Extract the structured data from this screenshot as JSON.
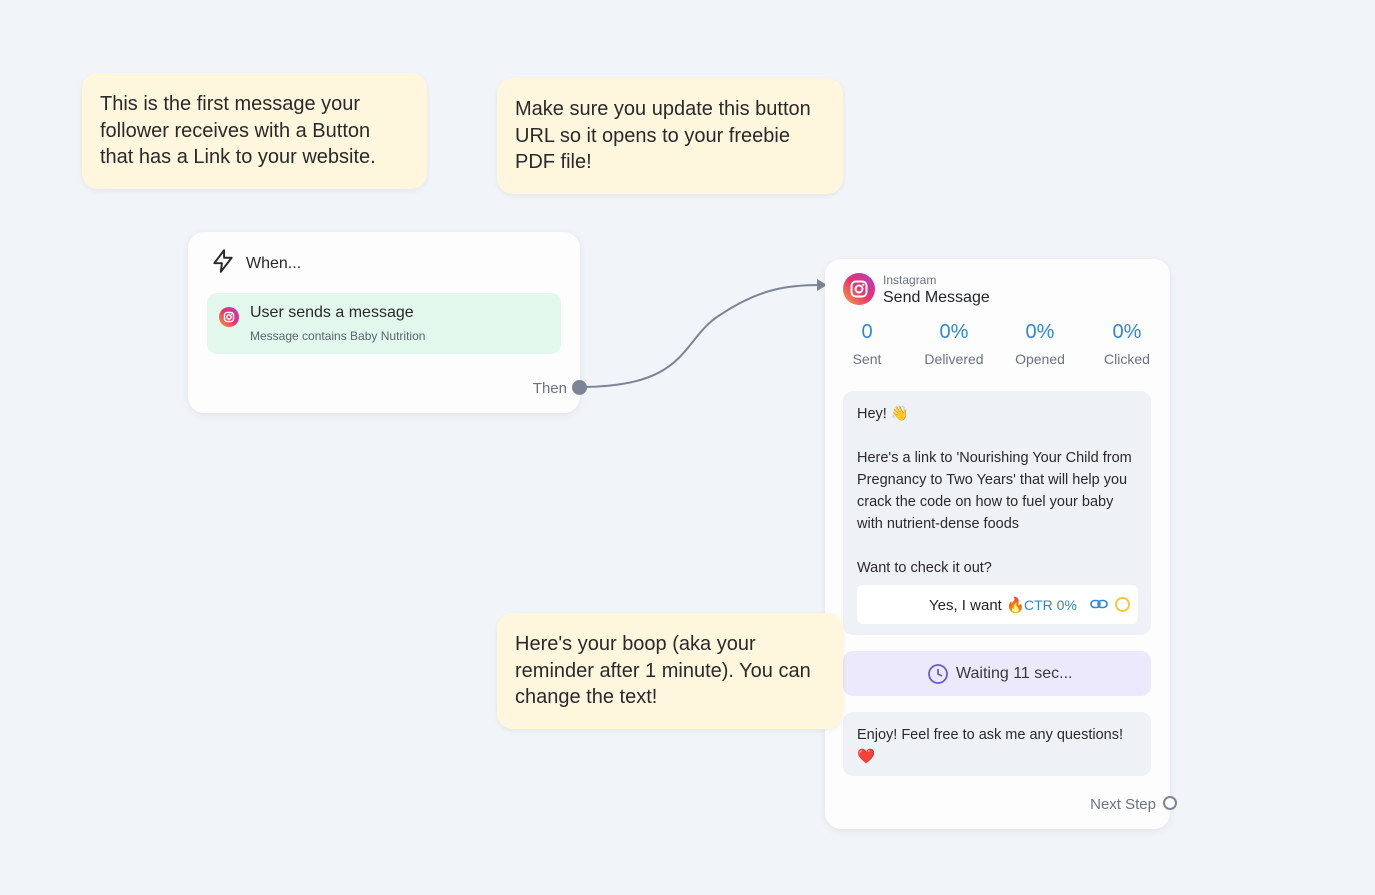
{
  "notes": [
    {
      "text": "This is the first message your follower receives with a Button that has a Link to your website."
    },
    {
      "text": "Make sure you update this button URL so it opens to your freebie PDF file!"
    },
    {
      "text": "Here's your boop (aka your reminder after 1 minute). You can change the text!"
    }
  ],
  "trigger": {
    "icon": "lightning-icon",
    "when_label": "When...",
    "title": "User sends a message",
    "condition": "Message contains Baby Nutrition",
    "then_label": "Then"
  },
  "action": {
    "platform": "Instagram",
    "title": "Send Message",
    "stats": [
      {
        "value": "0",
        "label": "Sent"
      },
      {
        "value": "0%",
        "label": "Delivered"
      },
      {
        "value": "0%",
        "label": "Opened"
      },
      {
        "value": "0%",
        "label": "Clicked"
      }
    ],
    "message1": "Hey! 👋\n\nHere's a link to 'Nourishing Your Child from Pregnancy to Two Years' that will help you crack the code on how to fuel your baby with nutrient-dense foods\n\nWant to check it out?",
    "button": {
      "label": "Yes, I want 🔥",
      "ctr": "CTR 0%"
    },
    "wait_label": "Waiting 11 sec...",
    "message2": "Enjoy! Feel free to ask me any questions! ❤️",
    "next_label": "Next Step"
  },
  "colors": {
    "background": "#f1f4f8",
    "note": "#fff6de",
    "trigger_box": "#e2f8ec",
    "accent_blue": "#2f86d9",
    "wait_box": "#ece9fd",
    "connector": "#7c8596"
  }
}
